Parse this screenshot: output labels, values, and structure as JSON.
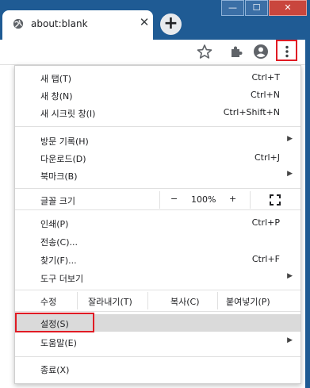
{
  "tab": {
    "title": "about:blank",
    "close_glyph": "✕"
  },
  "newtab": {
    "glyph": "+"
  },
  "window": {
    "minimize": "—",
    "maximize": "☐",
    "close": "✕"
  },
  "toolbar": {
    "icons": [
      "star-icon",
      "extensions-icon",
      "profile-icon",
      "menu-icon"
    ],
    "menu_glyph": "⋮"
  },
  "menu": {
    "new_tab": {
      "label": "새 탭(T)",
      "shortcut": "Ctrl+T"
    },
    "new_window": {
      "label": "새 창(N)",
      "shortcut": "Ctrl+N"
    },
    "incognito": {
      "label": "새 시크릿 창(I)",
      "shortcut": "Ctrl+Shift+N"
    },
    "history": {
      "label": "방문 기록(H)"
    },
    "downloads": {
      "label": "다운로드(D)",
      "shortcut": "Ctrl+J"
    },
    "bookmarks": {
      "label": "북마크(B)"
    },
    "zoom": {
      "label": "글꼴 크기",
      "minus": "−",
      "value": "100%",
      "plus": "+"
    },
    "print": {
      "label": "인쇄(P)",
      "shortcut": "Ctrl+P"
    },
    "cast": {
      "label": "전송(C)..."
    },
    "find": {
      "label": "찾기(F)...",
      "shortcut": "Ctrl+F"
    },
    "more_tools": {
      "label": "도구 더보기"
    },
    "edit": {
      "label": "수정",
      "cut": "잘라내기(T)",
      "copy": "복사(C)",
      "paste": "붙여넣기(P)"
    },
    "settings": {
      "label": "설정(S)"
    },
    "help": {
      "label": "도움말(E)"
    },
    "exit": {
      "label": "종료(X)"
    }
  },
  "colors": {
    "frame": "#1f5b94",
    "highlight": "#dadada",
    "annotation": "#e01b24"
  }
}
